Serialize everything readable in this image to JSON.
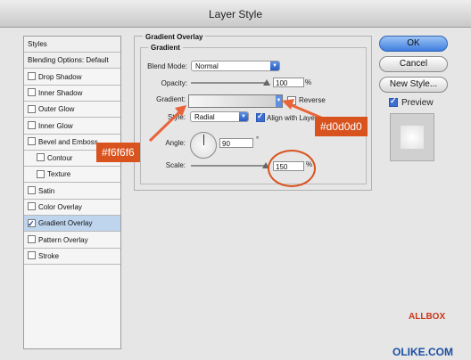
{
  "window": {
    "title": "Layer Style"
  },
  "sidebar": {
    "items": [
      {
        "label": "Styles",
        "type": "head"
      },
      {
        "label": "Blending Options: Default",
        "type": "head"
      },
      {
        "label": "Drop Shadow",
        "checked": false
      },
      {
        "label": "Inner Shadow",
        "checked": false
      },
      {
        "label": "Outer Glow",
        "checked": false
      },
      {
        "label": "Inner Glow",
        "checked": false
      },
      {
        "label": "Bevel and Emboss",
        "checked": false
      },
      {
        "label": "Contour",
        "checked": false,
        "sub": true
      },
      {
        "label": "Texture",
        "checked": false,
        "sub": true
      },
      {
        "label": "Satin",
        "checked": false
      },
      {
        "label": "Color Overlay",
        "checked": false
      },
      {
        "label": "Gradient Overlay",
        "checked": true,
        "active": true
      },
      {
        "label": "Pattern Overlay",
        "checked": false
      },
      {
        "label": "Stroke",
        "checked": false
      }
    ]
  },
  "panel": {
    "title": "Gradient Overlay",
    "section": "Gradient",
    "blend_mode_label": "Blend Mode:",
    "blend_mode_value": "Normal",
    "opacity_label": "Opacity:",
    "opacity_value": "100",
    "opacity_unit": "%",
    "gradient_label": "Gradient:",
    "reverse_label": "Reverse",
    "style_label": "Style:",
    "style_value": "Radial",
    "align_label": "Align with Layer",
    "angle_label": "Angle:",
    "angle_value": "90",
    "angle_unit": "°",
    "scale_label": "Scale:",
    "scale_value": "150",
    "scale_unit": "%"
  },
  "buttons": {
    "ok": "OK",
    "cancel": "Cancel",
    "new_style": "New Style...",
    "preview": "Preview"
  },
  "annotations": {
    "left_color": "#f6f6f6",
    "right_color": "#d0d0d0"
  },
  "colors": {
    "accent": "#3f7fe0",
    "annotation_bg": "#d9531e",
    "annotation_arrow": "#e8643a"
  },
  "watermark": {
    "line1": "OLIKE.COM",
    "line2": "ALLBOX"
  }
}
